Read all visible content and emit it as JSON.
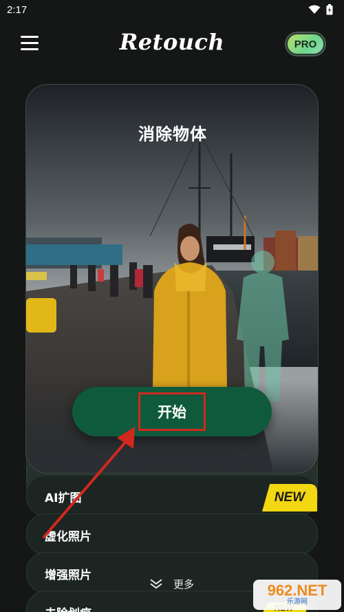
{
  "status_bar": {
    "time": "2:17"
  },
  "header": {
    "logo": "Retouch",
    "pro_badge": "PRO"
  },
  "main_card": {
    "title": "消除物体",
    "start_button": "开始"
  },
  "features": [
    {
      "label": "AI扩图",
      "badge": "NEW"
    },
    {
      "label": "虚化照片"
    },
    {
      "label": "增强照片"
    },
    {
      "label": "去除划痕",
      "badge": "NEW"
    }
  ],
  "more_label": "更多",
  "watermark": {
    "top": "962.NET",
    "bottom": "乐游网"
  },
  "colors": {
    "accent_green": "#0f5a3c",
    "highlight_red": "#d2281e",
    "new_badge": "#f2d712",
    "background": "#141716"
  }
}
